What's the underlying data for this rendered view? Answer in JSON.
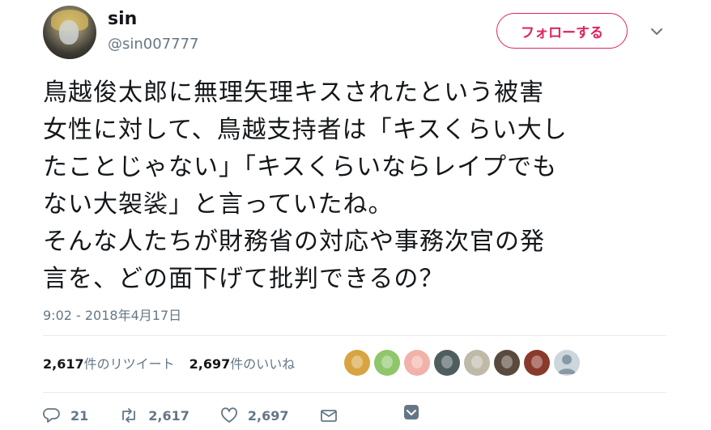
{
  "user": {
    "display_name": "sin",
    "handle": "@sin007777"
  },
  "follow_button_label": "フォローする",
  "tweet_text": "鳥越俊太郎に無理矢理キスされたという被害\n女性に対して、鳥越支持者は「キスくらい大し\nたことじゃない」「キスくらいならレイプでも\nない大袈裟」と言っていたね。\nそんな人たちが財務省の対応や事務次官の発\n言を、どの面下げて批判できるの？",
  "timestamp": "9:02 - 2018年4月17日",
  "stats": {
    "retweet_count": "2,617",
    "retweet_label": "件のリツイート",
    "like_count": "2,697",
    "like_label": "件のいいね"
  },
  "likers": [
    {
      "icon": "liker-avatar",
      "color": "#d7a441"
    },
    {
      "icon": "liker-avatar",
      "color": "#8fc66a"
    },
    {
      "icon": "liker-avatar",
      "color": "#f1b2a9"
    },
    {
      "icon": "liker-avatar",
      "color": "#4f5d5f"
    },
    {
      "icon": "liker-avatar",
      "color": "#bfb9a8"
    },
    {
      "icon": "liker-avatar",
      "color": "#5a4a3e"
    },
    {
      "icon": "liker-avatar",
      "color": "#8a3a2c"
    },
    {
      "icon": "default-avatar",
      "color": "#ccd6dd"
    }
  ],
  "actions": {
    "reply_count": "21",
    "retweet_count": "2,617",
    "like_count": "2,697"
  },
  "colors": {
    "accent": "#e0245e",
    "muted": "#657786",
    "text": "#14171a"
  }
}
